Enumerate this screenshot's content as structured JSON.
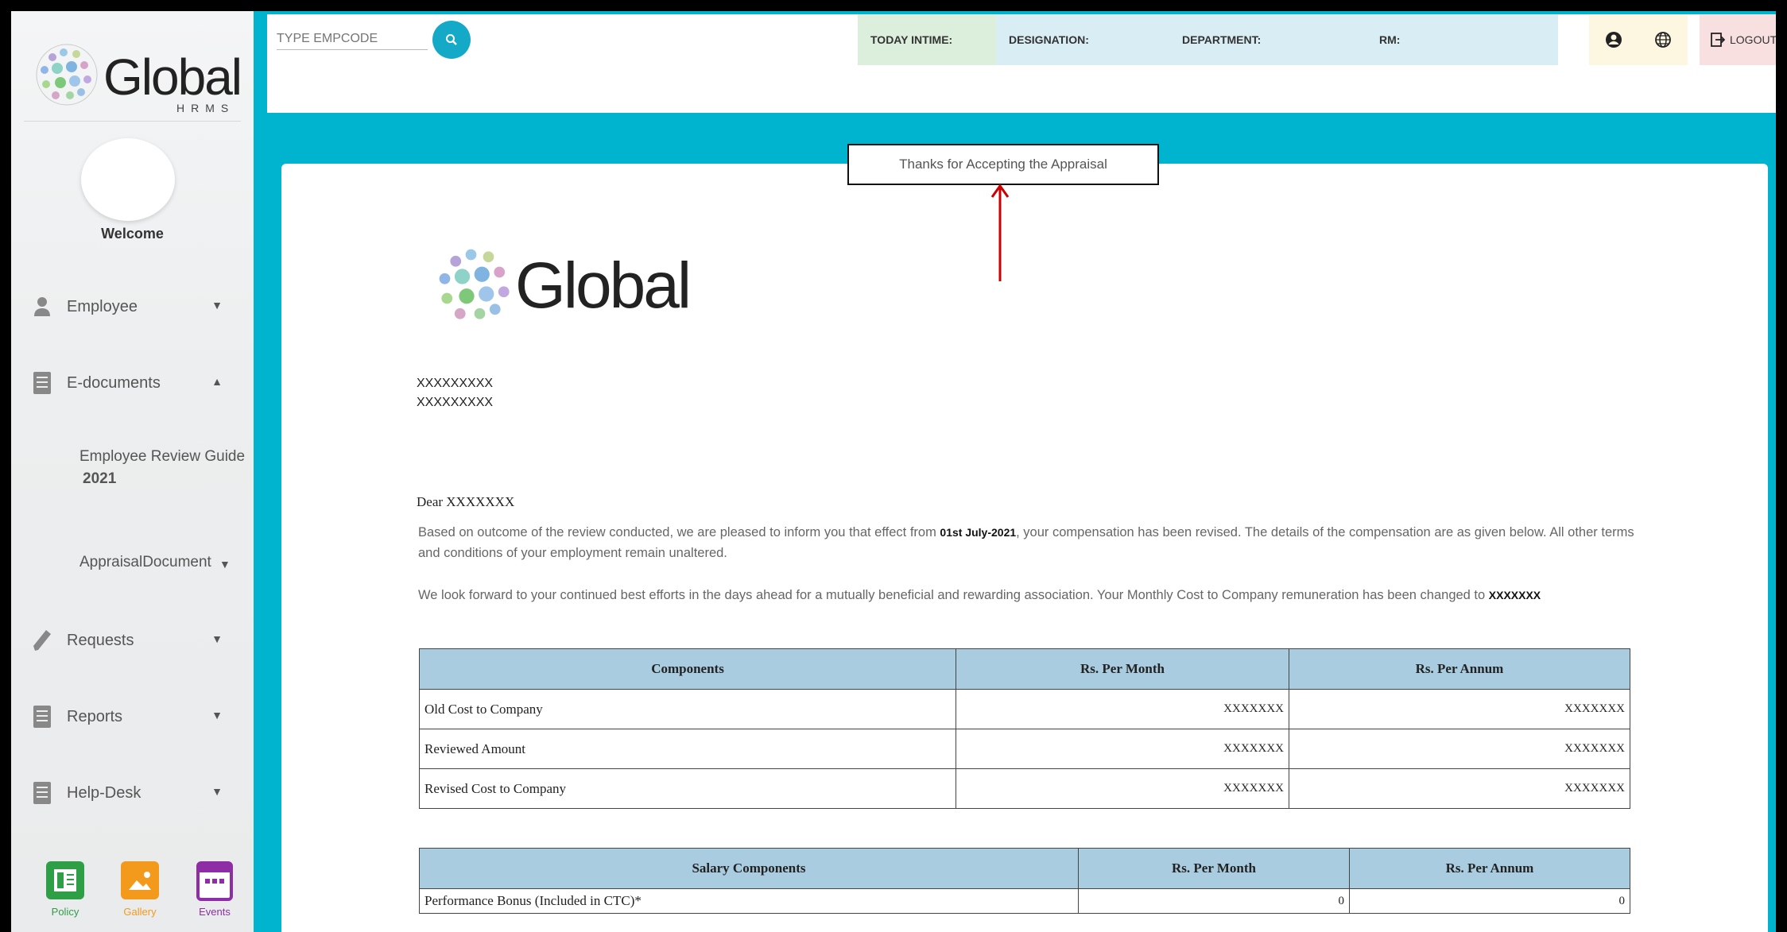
{
  "app": {
    "logo_text": "Global",
    "logo_subtext": "HRMS"
  },
  "sidebar": {
    "welcome": "Welcome",
    "items": [
      {
        "label": "Employee",
        "icon": "person-icon"
      },
      {
        "label": "E-documents",
        "icon": "document-icon"
      },
      {
        "label": "Requests",
        "icon": "pencil-icon"
      },
      {
        "label": "Reports",
        "icon": "document-icon"
      },
      {
        "label": "Help-Desk",
        "icon": "document-icon"
      }
    ],
    "subitems": [
      {
        "label_line1": "Employee Review Guide",
        "label_line2": "2021"
      },
      {
        "label": "AppraisalDocument"
      }
    ],
    "bottom": [
      {
        "label": "Policy",
        "color": "#2e9e47"
      },
      {
        "label": "Gallery",
        "color": "#f39a1c"
      },
      {
        "label": "Events",
        "color": "#8e2da6"
      }
    ]
  },
  "topbar": {
    "empcode_placeholder": "TYPE EMPCODE",
    "today_intime": "TODAY INTIME:",
    "designation": "DESIGNATION:",
    "department": "DEPARTMENT:",
    "rm": "RM:",
    "logout": "LOGOUT"
  },
  "document": {
    "notice": "Thanks for Accepting the Appraisal",
    "logo_text": "Global",
    "address_line1": "XXXXXXXXX",
    "address_line2": "XXXXXXXXX",
    "greeting": "Dear XXXXXXX",
    "para1_start": "Based on outcome of the review conducted, we are pleased to inform you that effect from ",
    "para1_date": "01st July-2021",
    "para1_end": ", your compensation has been revised. The details of the compensation are as given below. All other terms and conditions of your employment remain unaltered.",
    "para2_start": "We look forward to your continued best efforts in the days ahead for a mutually beneficial and rewarding association. Your Monthly Cost to Company remuneration has been changed to ",
    "para2_value": "XXXXXXX",
    "table1": {
      "headers": [
        "Components",
        "Rs. Per Month",
        "Rs. Per Annum"
      ],
      "rows": [
        [
          "Old Cost to Company",
          "XXXXXXX",
          "XXXXXXX"
        ],
        [
          "Reviewed Amount",
          "XXXXXXX",
          "XXXXXXX"
        ],
        [
          "Revised Cost to Company",
          "XXXXXXX",
          "XXXXXXX"
        ]
      ]
    },
    "table2": {
      "headers": [
        "Salary Components",
        "Rs. Per Month",
        "Rs. Per Annum"
      ],
      "rows": [
        [
          "Performance Bonus (Included in CTC)*",
          "0",
          "0"
        ]
      ]
    }
  },
  "colors": {
    "accent": "#00b4d0",
    "table_header": "#a9cce0",
    "search_button": "#15a9c8"
  }
}
